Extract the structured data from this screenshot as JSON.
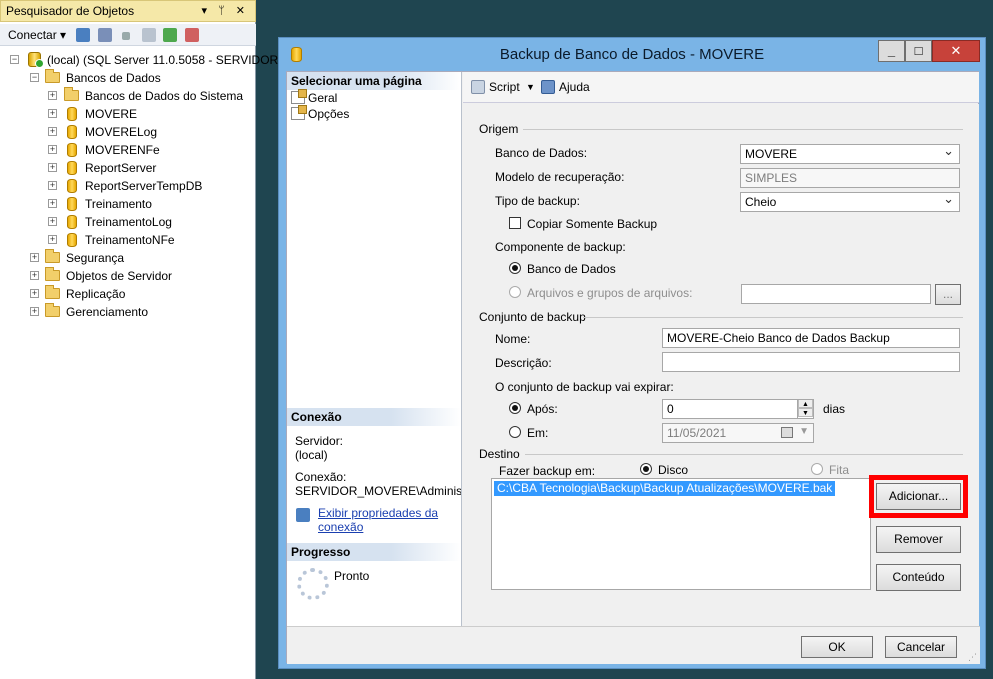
{
  "object_explorer": {
    "title": "Pesquisador de Objetos",
    "title_controls": "▾ ᛘ ✕",
    "connect_label": "Conectar",
    "tree": {
      "server": "(local) (SQL Server 11.0.5058 - SERVIDOR",
      "databases_folder": "Bancos de Dados",
      "system_dbs": "Bancos de Dados do Sistema",
      "databases": [
        "MOVERE",
        "MOVERELog",
        "MOVERENFe",
        "ReportServer",
        "ReportServerTempDB",
        "Treinamento",
        "TreinamentoLog",
        "TreinamentoNFe"
      ],
      "top_folders": [
        "Segurança",
        "Objetos de Servidor",
        "Replicação",
        "Gerenciamento"
      ]
    }
  },
  "dialog": {
    "title": "Backup de Banco de Dados - MOVERE",
    "nav": {
      "select_page_header": "Selecionar uma página",
      "pages": [
        "Geral",
        "Opções"
      ],
      "connection_header": "Conexão",
      "server_label": "Servidor:",
      "server_value": "(local)",
      "connection_label": "Conexão:",
      "connection_value": "SERVIDOR_MOVERE\\Administra",
      "view_props_line1": "Exibir propriedades da",
      "view_props_line2": "conexão",
      "progress_header": "Progresso",
      "progress_status": "Pronto"
    },
    "toolbar": {
      "script": "Script",
      "help": "Ajuda"
    },
    "origem": {
      "section": "Origem",
      "database_label": "Banco de Dados:",
      "database_value": "MOVERE",
      "recovery_label": "Modelo de recuperação:",
      "recovery_value": "SIMPLES",
      "backup_type_label": "Tipo de backup:",
      "backup_type_value": "Cheio",
      "copy_only_label": "Copiar Somente Backup",
      "component_label": "Componente de backup:",
      "component_db": "Banco de Dados",
      "component_files": "Arquivos e grupos de arquivos:",
      "files_button": "..."
    },
    "conjunto": {
      "section": "Conjunto de backup",
      "name_label": "Nome:",
      "name_value": "MOVERE-Cheio Banco de Dados Backup",
      "desc_label": "Descrição:",
      "desc_value": "",
      "expire_label": "O conjunto de backup vai expirar:",
      "after_label": "Após:",
      "after_value": "0",
      "days_label": "dias",
      "on_label": "Em:",
      "on_value": "11/05/2021"
    },
    "destino": {
      "section": "Destino",
      "backup_to_label": "Fazer backup em:",
      "disk_label": "Disco",
      "tape_label": "Fita",
      "path": "C:\\CBA Tecnologia\\Backup\\Backup Atualizações\\MOVERE.bak",
      "add_button": "Adicionar...",
      "remove_button": "Remover",
      "contents_button": "Conteúdo"
    },
    "ok_button": "OK",
    "cancel_button": "Cancelar"
  },
  "colors": {
    "highlight_box": "#ff0000",
    "selection": "#3399ff",
    "window_frame": "#7ab4e6"
  }
}
